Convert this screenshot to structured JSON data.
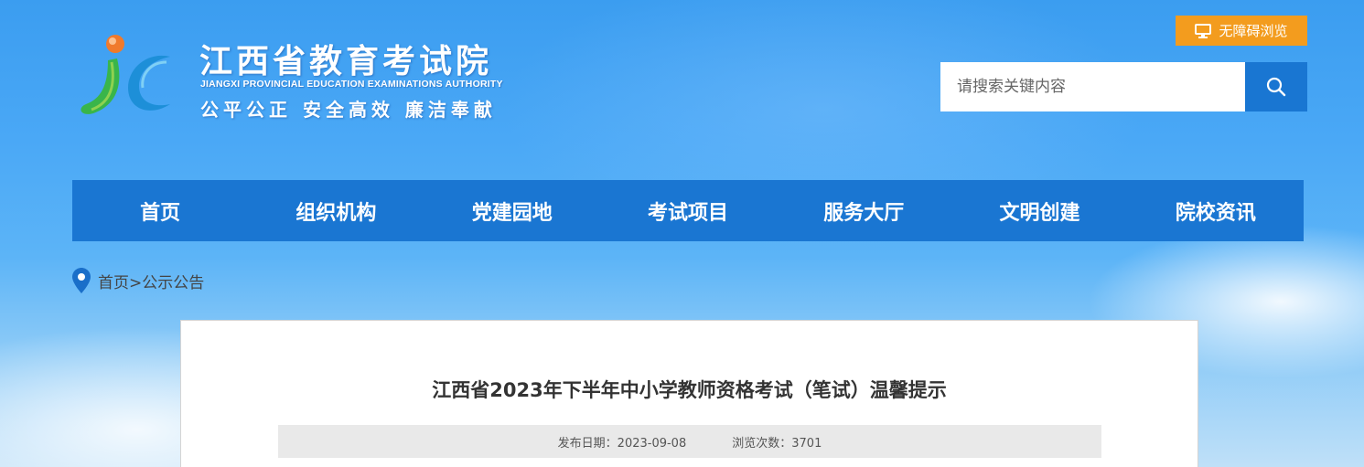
{
  "logo": {
    "title": "江西省教育考试院",
    "subtitle_en": "JIANGXI PROVINCIAL EDUCATION EXAMINATIONS AUTHORITY",
    "slogan": "公平公正  安全高效  廉洁奉献"
  },
  "header": {
    "accessibility_label": "无障碍浏览",
    "accessibility_icon": "monitor-icon",
    "accent_color": "#f39c1e"
  },
  "search": {
    "placeholder": "请搜索关键内容",
    "value": "",
    "icon": "search-icon",
    "button_color": "#1976d2"
  },
  "nav": {
    "color": "#1a76d2",
    "items": [
      "首页",
      "组织机构",
      "党建园地",
      "考试项目",
      "服务大厅",
      "文明创建",
      "院校资讯"
    ]
  },
  "breadcrumb": {
    "icon": "location-pin-icon",
    "home": "首页",
    "separator": ">",
    "current": "公示公告"
  },
  "article": {
    "title": "江西省2023年下半年中小学教师资格考试（笔试）温馨提示",
    "date_label": "发布日期：",
    "date": "2023-09-08",
    "views_label": "浏览次数：",
    "views": "3701"
  }
}
